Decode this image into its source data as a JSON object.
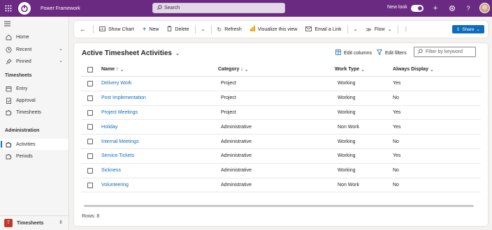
{
  "header": {
    "app_name": "Power Framework",
    "search_placeholder": "Search",
    "new_look_label": "New look"
  },
  "sidebar": {
    "items": [
      {
        "label": "Home",
        "icon": "home-icon"
      },
      {
        "label": "Recent",
        "icon": "clock-icon"
      },
      {
        "label": "Pinned",
        "icon": "pin-icon"
      }
    ],
    "sections": [
      {
        "title": "Timesheets",
        "items": [
          "Entry",
          "Approval",
          "Timesheets"
        ]
      },
      {
        "title": "Administration",
        "items": [
          "Activities",
          "Periods"
        ]
      }
    ],
    "active_item": "Activities",
    "area": {
      "badge": "T",
      "name": "Timesheets"
    }
  },
  "commands": {
    "show_chart": "Show Chart",
    "new": "New",
    "delete": "Delete",
    "refresh": "Refresh",
    "visualize": "Visualize this view",
    "email_link": "Email a Link",
    "flow": "Flow",
    "share": "Share"
  },
  "view": {
    "title": "Active Timesheet Activities",
    "edit_columns": "Edit columns",
    "edit_filters": "Edit filters",
    "filter_placeholder": "Filter by keyword"
  },
  "table": {
    "columns": [
      "Name ↑",
      "Category ↓",
      "Work Type",
      "Always Display"
    ],
    "rows": [
      [
        "Delivery Work",
        "Project",
        "Working",
        "Yes"
      ],
      [
        "Post Implementation",
        "Project",
        "Working",
        "No"
      ],
      [
        "Project Meetings",
        "Project",
        "Working",
        "Yes"
      ],
      [
        "Holiday",
        "Administrative",
        "Non Work",
        "Yes"
      ],
      [
        "Internal Meetings",
        "Administrative",
        "Working",
        "No"
      ],
      [
        "Service Tickets",
        "Administrative",
        "Working",
        "Yes"
      ],
      [
        "Sickness",
        "Administrative",
        "Working",
        "No"
      ],
      [
        "Volunteering",
        "Administrative",
        "Non Work",
        "No"
      ]
    ]
  },
  "footer": {
    "rows_count": "Rows: 8"
  },
  "colors": {
    "brand": "#6b2a82",
    "accent": "#0f6cbd"
  }
}
